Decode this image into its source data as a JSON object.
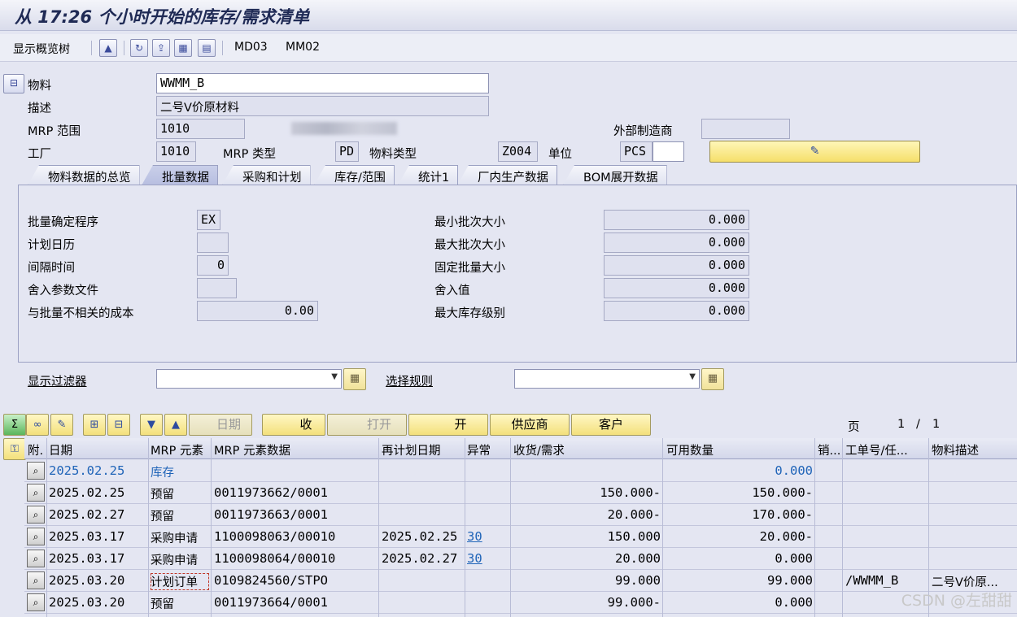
{
  "title": "从 17:26 个小时开始的库存/需求清单",
  "toolbar": {
    "show_tree": "显示概览树",
    "md03": "MD03",
    "mm02": "MM02"
  },
  "header": {
    "material_label": "物料",
    "material_value": "WWMM_B",
    "desc_label": "描述",
    "desc_value": "二号V价原材料",
    "mrp_area_label": "MRP 范围",
    "mrp_area_value": "1010",
    "ext_mfr_label": "外部制造商",
    "plant_label": "工厂",
    "plant_value": "1010",
    "mrp_type_label": "MRP 类型",
    "mrp_type_value": "PD",
    "mat_type_label": "物料类型",
    "mat_type_value": "Z004",
    "unit_label": "单位",
    "unit_value": "PCS"
  },
  "tabs": [
    "物料数据的总览",
    "批量数据",
    "采购和计划",
    "库存/范围",
    "统计1",
    "厂内生产数据",
    "BOM展开数据"
  ],
  "lot": {
    "proc_label": "批量确定程序",
    "proc_value": "EX",
    "cal_label": "计划日历",
    "interval_label": "间隔时间",
    "interval_value": "0",
    "round_file_label": "舍入参数文件",
    "cost_label": "与批量不相关的成本",
    "cost_value": "0.00",
    "min_label": "最小批次大小",
    "min_value": "0.000",
    "max_label": "最大批次大小",
    "max_value": "0.000",
    "fixed_label": "固定批量大小",
    "fixed_value": "0.000",
    "round_label": "舍入值",
    "round_value": "0.000",
    "maxstock_label": "最大库存级别",
    "maxstock_value": "0.000"
  },
  "filter": {
    "label": "显示过滤器",
    "rule_label": "选择规则"
  },
  "grid_toolbar": {
    "date": "日期",
    "receive": "收",
    "open": "打开",
    "start": "开",
    "supplier": "供应商",
    "customer": "客户",
    "page_label": "页",
    "page": "1",
    "sep": "/",
    "pages": "1"
  },
  "columns": [
    "附.",
    "日期",
    "MRP 元素",
    "MRP 元素数据",
    "再计划日期",
    "异常",
    "收货/需求",
    "可用数量",
    "销...",
    "工单号/任...",
    "物料描述"
  ],
  "rows": [
    {
      "date": "2025.02.25",
      "elem": "库存",
      "data": "",
      "resched": "",
      "exc": "",
      "qty": "",
      "avail": "0.000",
      "order": "",
      "desc": ""
    },
    {
      "date": "2025.02.25",
      "elem": "预留",
      "data": "0011973662/0001",
      "resched": "",
      "exc": "",
      "qty": "150.000-",
      "avail": "150.000-",
      "order": "",
      "desc": ""
    },
    {
      "date": "2025.02.27",
      "elem": "预留",
      "data": "0011973663/0001",
      "resched": "",
      "exc": "",
      "qty": "20.000-",
      "avail": "170.000-",
      "order": "",
      "desc": ""
    },
    {
      "date": "2025.03.17",
      "elem": "采购申请",
      "data": "1100098063/00010",
      "resched": "2025.02.25",
      "exc": "30",
      "qty": "150.000",
      "avail": "20.000-",
      "order": "",
      "desc": ""
    },
    {
      "date": "2025.03.17",
      "elem": "采购申请",
      "data": "1100098064/00010",
      "resched": "2025.02.27",
      "exc": "30",
      "qty": "20.000",
      "avail": "0.000",
      "order": "",
      "desc": ""
    },
    {
      "date": "2025.03.20",
      "elem": "计划订单",
      "data": "0109824560/STPO",
      "resched": "",
      "exc": "",
      "qty": "99.000",
      "avail": "99.000",
      "order": "/WWMM_B",
      "desc": "二号V价原..."
    },
    {
      "date": "2025.03.20",
      "elem": "预留",
      "data": "0011973664/0001",
      "resched": "",
      "exc": "",
      "qty": "99.000-",
      "avail": "0.000",
      "order": "",
      "desc": ""
    }
  ],
  "watermark": "CSDN @左甜甜"
}
